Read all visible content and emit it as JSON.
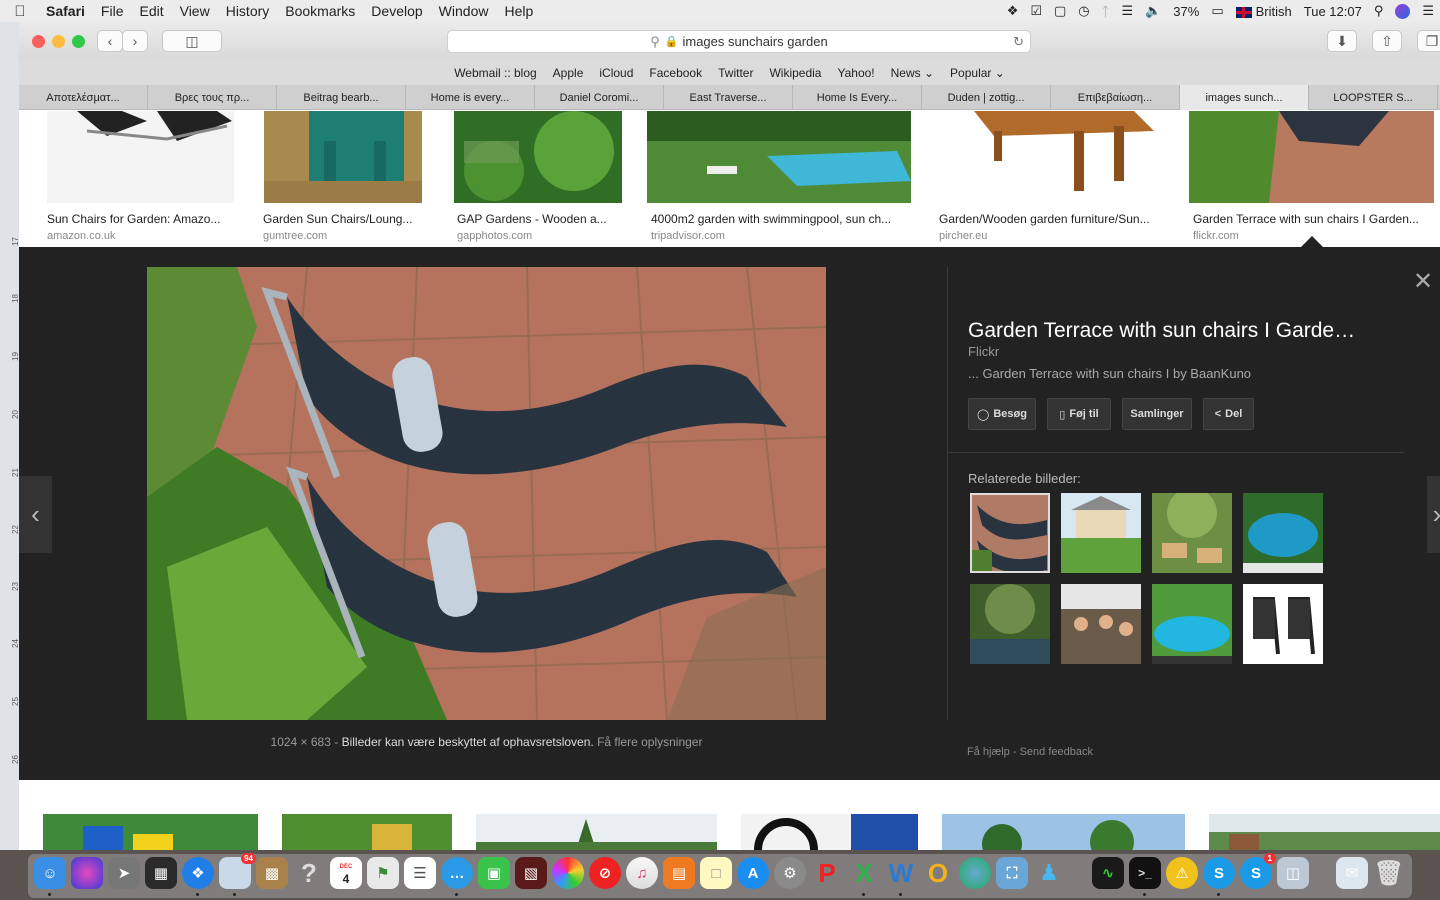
{
  "menubar": {
    "apple_icon": "apple-icon",
    "app": "Safari",
    "menus": [
      "File",
      "Edit",
      "View",
      "History",
      "Bookmarks",
      "Develop",
      "Window",
      "Help"
    ],
    "battery": "37%",
    "input_source": "British",
    "clock": "Tue 12:07"
  },
  "toolbar": {
    "url": "images sunchairs garden"
  },
  "favorites": [
    "Webmail :: blog",
    "Apple",
    "iCloud",
    "Facebook",
    "Twitter",
    "Wikipedia",
    "Yahoo!",
    "News ⌄",
    "Popular ⌄"
  ],
  "tabs": [
    "Αποτελέσματ...",
    "Βρες τους πρ...",
    "Beitrag bearb...",
    "Home is every...",
    "Daniel Coromi...",
    "East Traverse...",
    "Home Is Every...",
    "Duden | zottig...",
    "Επιβεβαίωση...",
    "images sunch...",
    "LOOPSTER S..."
  ],
  "active_tab": 9,
  "results_top": [
    {
      "caption": "Sun Chairs for Garden: Amazo...",
      "source": "amazon.co.uk"
    },
    {
      "caption": "Garden Sun Chairs/Loung...",
      "source": "gumtree.com"
    },
    {
      "caption": "GAP Gardens - Wooden a...",
      "source": "gapphotos.com"
    },
    {
      "caption": "4000m2 garden with swimmingpool, sun ch...",
      "source": "tripadvisor.com"
    },
    {
      "caption": "Garden/Wooden garden furniture/Sun...",
      "source": "pircher.eu"
    },
    {
      "caption": "Garden Terrace with sun chairs I Garden...",
      "source": "flickr.com"
    }
  ],
  "preview": {
    "title": "Garden Terrace with sun chairs I Garde…",
    "site": "Flickr",
    "description": "... Garden Terrace with sun chairs I by BaanKuno",
    "buttons": [
      "Besøg",
      "Føj til",
      "Samlinger",
      "Del"
    ],
    "related_label": "Relaterede billeder:",
    "dimensions": "1024 × 683",
    "sep": " - ",
    "copyright": "Billeder kan være beskyttet af ophavsretsloven.",
    "more_info": "Få flere oplysninger",
    "help": "Få hjælp",
    "feedback": "Send feedback"
  },
  "dock": {
    "badges": {
      "photos": "94",
      "skype": "1"
    },
    "calendar_day": "4",
    "calendar_month": "DEC"
  }
}
